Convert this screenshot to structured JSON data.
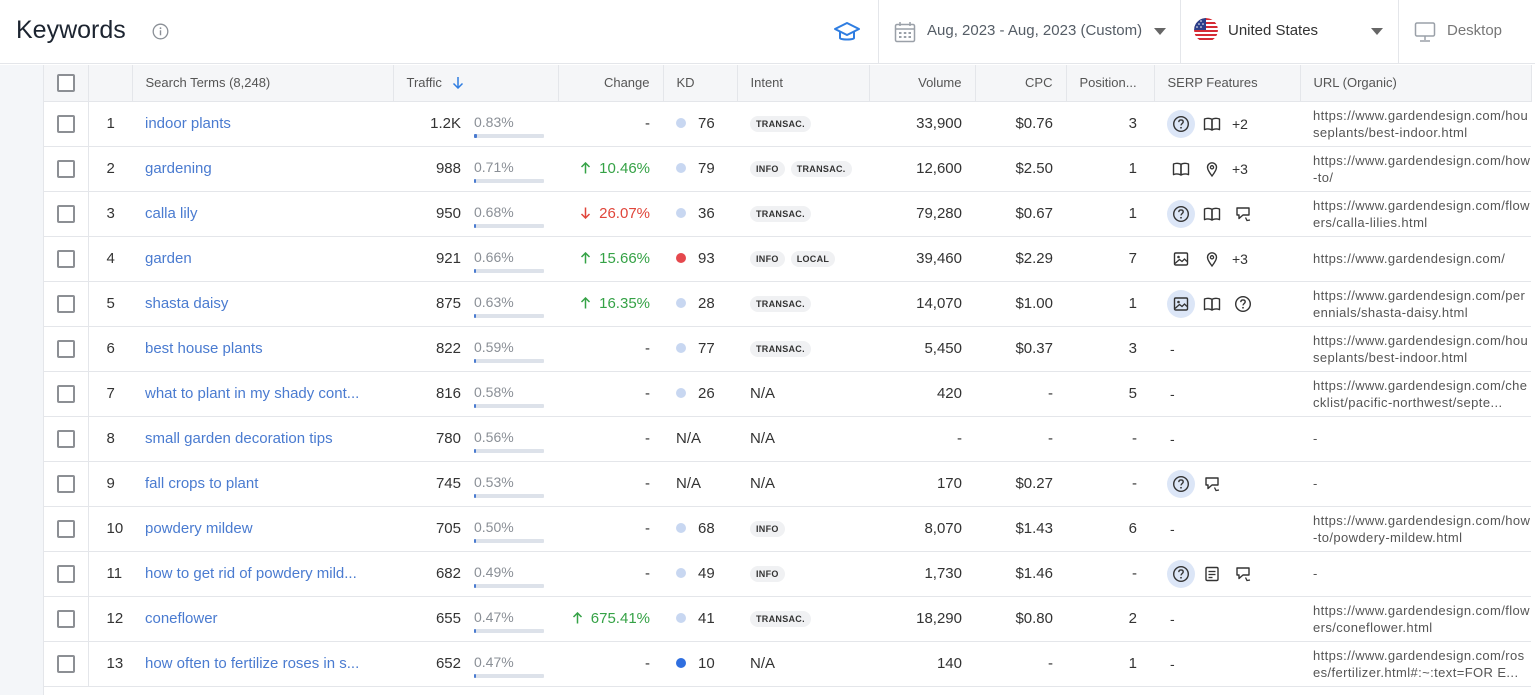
{
  "header": {
    "title": "Keywords",
    "date_range": "Aug, 2023 - Aug, 2023 (Custom)",
    "country": "United States",
    "device": "Desktop"
  },
  "colors": {
    "link": "#4a7bd0",
    "positive": "#35a246",
    "negative": "#e0453a",
    "kd_low": "#c8d7f1",
    "kd_high": "#e5484d",
    "kd_very_easy": "#2f6fe0",
    "serp_highlight": "#dce6f7"
  },
  "table": {
    "columns": {
      "search_terms": "Search Terms (8,248)",
      "traffic": "Traffic",
      "change": "Change",
      "kd": "KD",
      "intent": "Intent",
      "volume": "Volume",
      "cpc": "CPC",
      "position": "Position...",
      "serp": "SERP Features",
      "url": "URL (Organic)"
    },
    "rows": [
      {
        "idx": "1",
        "keyword": "indoor plants",
        "traffic": "1.2K",
        "share": "0.83%",
        "share_frac": 0.83,
        "change": "-",
        "change_dir": "none",
        "kd": "76",
        "kd_color": "low",
        "intent": [
          "TRANSAC."
        ],
        "volume": "33,900",
        "cpc": "$0.76",
        "position": "3",
        "serp": [
          {
            "icon": "question-icon",
            "hl": true
          },
          {
            "icon": "book-icon",
            "hl": false
          }
        ],
        "serp_more": "+2",
        "url": "https://www.gardendesign.com/houseplants/best-indoor.html"
      },
      {
        "idx": "2",
        "keyword": "gardening",
        "traffic": "988",
        "share": "0.71%",
        "share_frac": 0.71,
        "change": "10.46%",
        "change_dir": "up",
        "kd": "79",
        "kd_color": "low",
        "intent": [
          "INFO",
          "TRANSAC."
        ],
        "volume": "12,600",
        "cpc": "$2.50",
        "position": "1",
        "serp": [
          {
            "icon": "book-icon",
            "hl": false
          },
          {
            "icon": "location-pin-icon",
            "hl": false
          }
        ],
        "serp_more": "+3",
        "url": "https://www.gardendesign.com/how-to/"
      },
      {
        "idx": "3",
        "keyword": "calla lily",
        "traffic": "950",
        "share": "0.68%",
        "share_frac": 0.68,
        "change": "26.07%",
        "change_dir": "down",
        "kd": "36",
        "kd_color": "low",
        "intent": [
          "TRANSAC."
        ],
        "volume": "79,280",
        "cpc": "$0.67",
        "position": "1",
        "serp": [
          {
            "icon": "question-icon",
            "hl": true
          },
          {
            "icon": "book-icon",
            "hl": false
          },
          {
            "icon": "review-icon",
            "hl": false
          }
        ],
        "serp_more": "",
        "url": "https://www.gardendesign.com/flowers/calla-lilies.html"
      },
      {
        "idx": "4",
        "keyword": "garden",
        "traffic": "921",
        "share": "0.66%",
        "share_frac": 0.66,
        "change": "15.66%",
        "change_dir": "up",
        "kd": "93",
        "kd_color": "high",
        "intent": [
          "INFO",
          "LOCAL"
        ],
        "volume": "39,460",
        "cpc": "$2.29",
        "position": "7",
        "serp": [
          {
            "icon": "image-icon",
            "hl": false
          },
          {
            "icon": "location-pin-icon",
            "hl": false
          }
        ],
        "serp_more": "+3",
        "url": "https://www.gardendesign.com/"
      },
      {
        "idx": "5",
        "keyword": "shasta daisy",
        "traffic": "875",
        "share": "0.63%",
        "share_frac": 0.63,
        "change": "16.35%",
        "change_dir": "up",
        "kd": "28",
        "kd_color": "low",
        "intent": [
          "TRANSAC."
        ],
        "volume": "14,070",
        "cpc": "$1.00",
        "position": "1",
        "serp": [
          {
            "icon": "image-icon",
            "hl": true
          },
          {
            "icon": "book-icon",
            "hl": false
          },
          {
            "icon": "question-icon",
            "hl": false
          }
        ],
        "serp_more": "",
        "url": "https://www.gardendesign.com/perennials/shasta-daisy.html"
      },
      {
        "idx": "6",
        "keyword": "best house plants",
        "traffic": "822",
        "share": "0.59%",
        "share_frac": 0.59,
        "change": "-",
        "change_dir": "none",
        "kd": "77",
        "kd_color": "low",
        "intent": [
          "TRANSAC."
        ],
        "volume": "5,450",
        "cpc": "$0.37",
        "position": "3",
        "serp": [],
        "serp_more": "-",
        "url": "https://www.gardendesign.com/houseplants/best-indoor.html"
      },
      {
        "idx": "7",
        "keyword": "what to plant in my shady cont...",
        "traffic": "816",
        "share": "0.58%",
        "share_frac": 0.58,
        "change": "-",
        "change_dir": "none",
        "kd": "26",
        "kd_color": "low",
        "intent_text": "N/A",
        "volume": "420",
        "cpc": "-",
        "position": "5",
        "serp": [],
        "serp_more": "-",
        "url": "https://www.gardendesign.com/checklist/pacific-northwest/septe..."
      },
      {
        "idx": "8",
        "keyword": "small garden decoration tips",
        "traffic": "780",
        "share": "0.56%",
        "share_frac": 0.56,
        "change": "-",
        "change_dir": "none",
        "kd": "N/A",
        "kd_color": "none",
        "intent_text": "N/A",
        "volume": "-",
        "cpc": "-",
        "position": "-",
        "serp": [],
        "serp_more": "-",
        "url": "-"
      },
      {
        "idx": "9",
        "keyword": "fall crops to plant",
        "traffic": "745",
        "share": "0.53%",
        "share_frac": 0.53,
        "change": "-",
        "change_dir": "none",
        "kd": "N/A",
        "kd_color": "none",
        "intent_text": "N/A",
        "volume": "170",
        "cpc": "$0.27",
        "position": "-",
        "serp": [
          {
            "icon": "question-icon",
            "hl": true
          },
          {
            "icon": "review-icon",
            "hl": false
          }
        ],
        "serp_more": "",
        "url": "-"
      },
      {
        "idx": "10",
        "keyword": "powdery mildew",
        "traffic": "705",
        "share": "0.50%",
        "share_frac": 0.5,
        "change": "-",
        "change_dir": "none",
        "kd": "68",
        "kd_color": "low",
        "intent": [
          "INFO"
        ],
        "volume": "8,070",
        "cpc": "$1.43",
        "position": "6",
        "serp": [],
        "serp_more": "-",
        "url": "https://www.gardendesign.com/how-to/powdery-mildew.html"
      },
      {
        "idx": "11",
        "keyword": "how to get rid of powdery mild...",
        "traffic": "682",
        "share": "0.49%",
        "share_frac": 0.49,
        "change": "-",
        "change_dir": "none",
        "kd": "49",
        "kd_color": "low",
        "intent": [
          "INFO"
        ],
        "volume": "1,730",
        "cpc": "$1.46",
        "position": "-",
        "serp": [
          {
            "icon": "question-icon",
            "hl": true
          },
          {
            "icon": "article-icon",
            "hl": false
          },
          {
            "icon": "review-icon",
            "hl": false
          }
        ],
        "serp_more": "",
        "url": "-"
      },
      {
        "idx": "12",
        "keyword": "coneflower",
        "traffic": "655",
        "share": "0.47%",
        "share_frac": 0.47,
        "change": "675.41%",
        "change_dir": "up",
        "kd": "41",
        "kd_color": "low",
        "intent": [
          "TRANSAC."
        ],
        "volume": "18,290",
        "cpc": "$0.80",
        "position": "2",
        "serp": [],
        "serp_more": "-",
        "url": "https://www.gardendesign.com/flowers/coneflower.html"
      },
      {
        "idx": "13",
        "keyword": "how often to fertilize roses in s...",
        "traffic": "652",
        "share": "0.47%",
        "share_frac": 0.47,
        "change": "-",
        "change_dir": "none",
        "kd": "10",
        "kd_color": "very_easy",
        "intent_text": "N/A",
        "volume": "140",
        "cpc": "-",
        "position": "1",
        "serp": [],
        "serp_more": "-",
        "url": "https://www.gardendesign.com/roses/fertilizer.html#:~:text=FOR E..."
      }
    ]
  }
}
